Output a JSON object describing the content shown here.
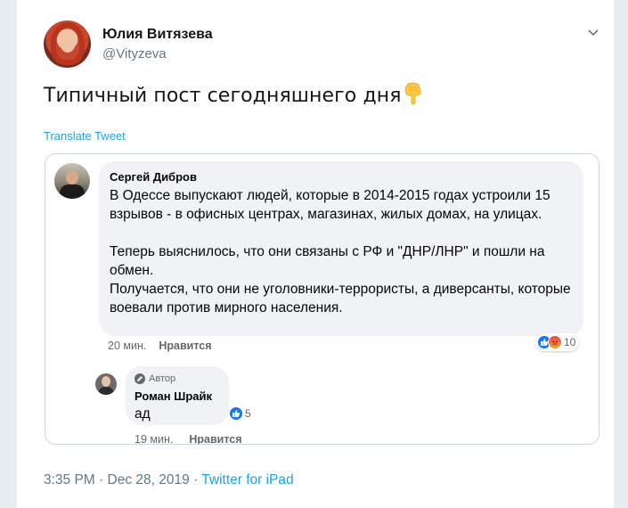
{
  "tweet": {
    "author_name": "Юлия Витязева",
    "author_handle": "@Vityzeva",
    "text": "Типичный пост сегодняшнего дня",
    "emoji": "point-down-hand-icon",
    "translate_label": "Translate Tweet",
    "time": "3:35 PM",
    "date": "Dec 28, 2019",
    "separator": "·",
    "source": "Twitter for iPad"
  },
  "embedded": {
    "comment1": {
      "author": "Сергей Дибров",
      "paragraph1": "В Одессе выпускают людей, которые в 2014-2015 годах устроили 15 взрывов - в офисных центрах, магазинах, жилых домах, на улицах.",
      "paragraph2": "Теперь выяснилось, что они связаны с РФ и \"ДНР/ЛНР\" и пошли на обмен.",
      "paragraph3": "Получается, что они не уголовники-террористы, а диверсанты, которые воевали против мирного населения.",
      "time": "20 мин.",
      "like_label": "Нравится",
      "reaction_count": "10"
    },
    "comment2": {
      "badge": "Автор",
      "author": "Роман Шрайк",
      "text": "ад",
      "time": "19 мин.",
      "like_label": "Нравится",
      "reaction_count": "5"
    }
  },
  "colors": {
    "link": "#1da1f2",
    "secondary": "#657786",
    "fb_like": "#1877f2",
    "bubble": "#f0f2f5"
  }
}
